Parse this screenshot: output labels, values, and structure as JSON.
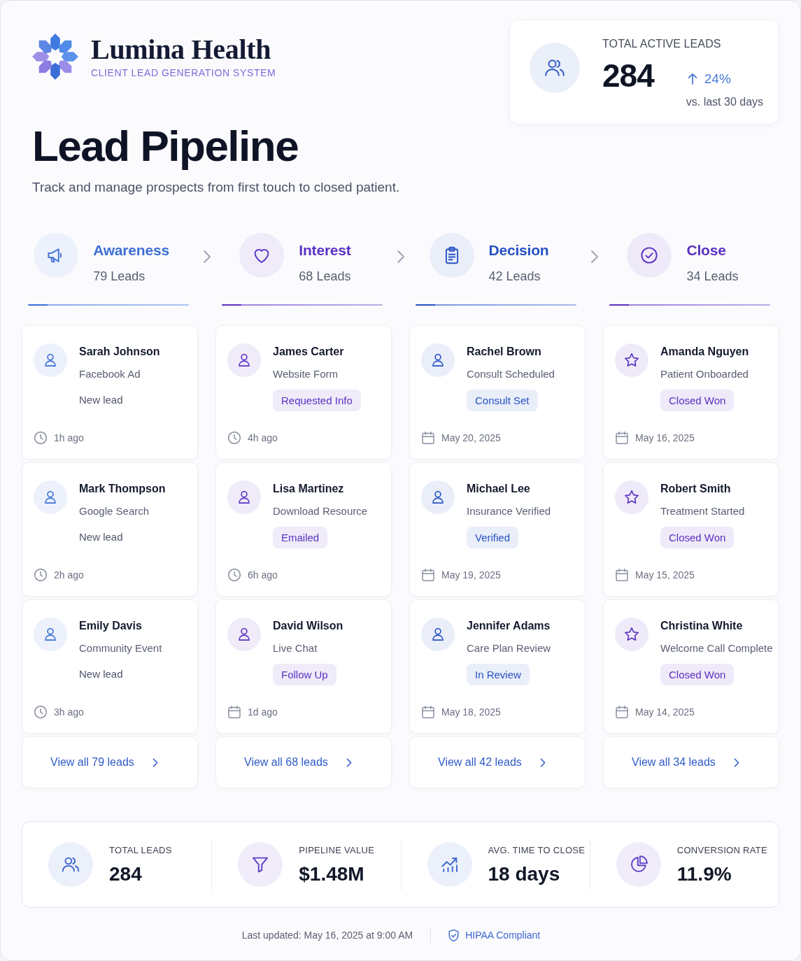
{
  "brand": {
    "name": "Lumina Health",
    "tagline": "CLIENT LEAD GENERATION SYSTEM"
  },
  "kpi": {
    "label": "TOTAL ACTIVE LEADS",
    "value": "284",
    "trend": "24%",
    "note": "vs. last 30 days"
  },
  "page": {
    "title": "Lead Pipeline",
    "subtitle": "Track and manage prospects from first touch to closed patient."
  },
  "stages": [
    {
      "title": "Awareness",
      "count": "79 Leads",
      "color": "#3d6fd6",
      "view_all": "View all 79 leads",
      "leads": [
        {
          "name": "Sarah Johnson",
          "source": "Facebook Ad",
          "status": {
            "kind": "text",
            "text": "New lead"
          },
          "time": {
            "kind": "hours",
            "text": "1h ago"
          }
        },
        {
          "name": "Mark Thompson",
          "source": "Google Search",
          "status": {
            "kind": "text",
            "text": "New lead"
          },
          "time": {
            "kind": "hours",
            "text": "2h ago"
          }
        },
        {
          "name": "Emily Davis",
          "source": "Community Event",
          "status": {
            "kind": "text",
            "text": "New lead"
          },
          "time": {
            "kind": "hours",
            "text": "3h ago"
          }
        }
      ]
    },
    {
      "title": "Interest",
      "count": "68 Leads",
      "color": "#5a32c2",
      "view_all": "View all 68 leads",
      "leads": [
        {
          "name": "James Carter",
          "source": "Website Form",
          "status": {
            "kind": "badge",
            "text": "Requested Info"
          },
          "time": {
            "kind": "hours",
            "text": "4h ago"
          }
        },
        {
          "name": "Lisa Martinez",
          "source": "Download Resource",
          "status": {
            "kind": "badge",
            "text": "Emailed"
          },
          "time": {
            "kind": "hours",
            "text": "6h ago"
          }
        },
        {
          "name": "David Wilson",
          "source": "Live Chat",
          "status": {
            "kind": "badge",
            "text": "Follow Up"
          },
          "time": {
            "kind": "days",
            "text": "1d ago"
          }
        }
      ]
    },
    {
      "title": "Decision",
      "count": "42 Leads",
      "color": "#2752c4",
      "view_all": "View all 42 leads",
      "leads": [
        {
          "name": "Rachel Brown",
          "source": "Consult Scheduled",
          "status": {
            "kind": "badge",
            "text": "Consult Set"
          },
          "time": {
            "kind": "days",
            "text": "May 20, 2025"
          }
        },
        {
          "name": "Michael Lee",
          "source": "Insurance Verified",
          "status": {
            "kind": "badge",
            "text": "Verified"
          },
          "time": {
            "kind": "days",
            "text": "May 19, 2025"
          }
        },
        {
          "name": "Jennifer Adams",
          "source": "Care Plan Review",
          "status": {
            "kind": "badge",
            "text": "In Review"
          },
          "time": {
            "kind": "days",
            "text": "May 18, 2025"
          }
        }
      ]
    },
    {
      "title": "Close",
      "count": "34 Leads",
      "color": "#5a30c0",
      "view_all": "View all 34 leads",
      "leads": [
        {
          "name": "Amanda Nguyen",
          "source": "Patient Onboarded",
          "status": {
            "kind": "badge",
            "text": "Closed Won"
          },
          "time": {
            "kind": "days",
            "text": "May 16, 2025"
          }
        },
        {
          "name": "Robert Smith",
          "source": "Treatment Started",
          "status": {
            "kind": "badge",
            "text": "Closed Won"
          },
          "time": {
            "kind": "days",
            "text": "May 15, 2025"
          }
        },
        {
          "name": "Christina White",
          "source": "Welcome Call Complete",
          "status": {
            "kind": "badge",
            "text": "Closed Won"
          },
          "time": {
            "kind": "days",
            "text": "May 14, 2025"
          }
        }
      ]
    }
  ],
  "summary": [
    {
      "label": "TOTAL LEADS",
      "value": "284"
    },
    {
      "label": "PIPELINE VALUE",
      "value": "$1.48M"
    },
    {
      "label": "AVG. TIME TO CLOSE",
      "value": "18 days"
    },
    {
      "label": "CONVERSION RATE",
      "value": "11.9%"
    }
  ],
  "footer": {
    "updated": "Last updated: May 16, 2025 at 9:00 AM",
    "compliance": "HIPAA Compliant"
  }
}
